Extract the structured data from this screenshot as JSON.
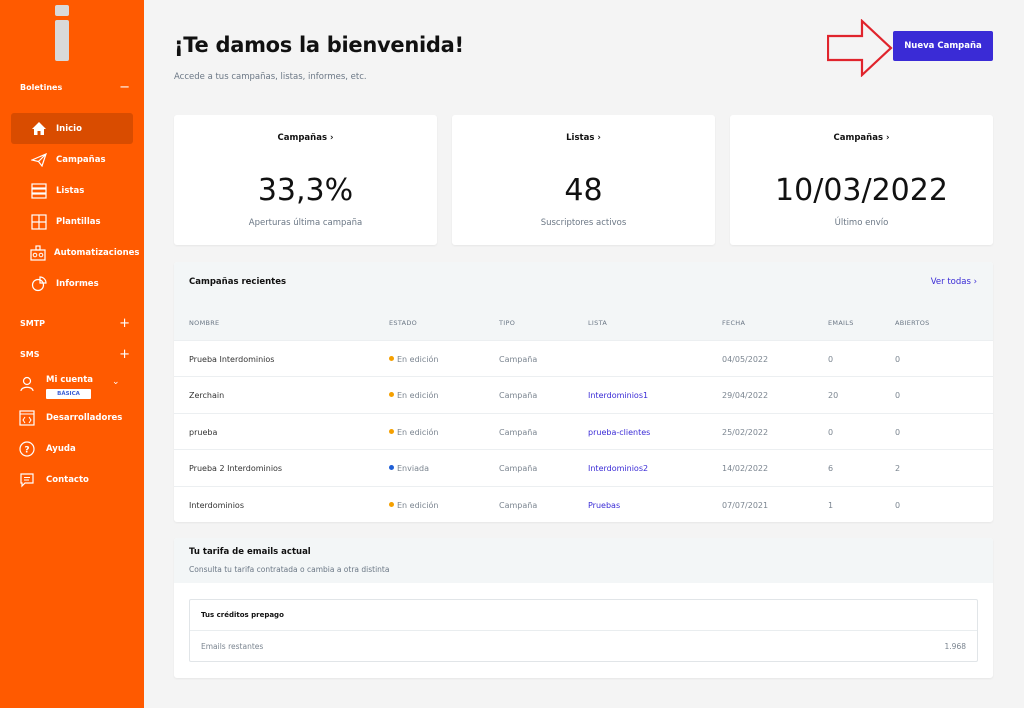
{
  "sidebar": {
    "sections": {
      "boletines": "Boletines",
      "smtp": "SMTP",
      "sms": "SMS"
    },
    "items": [
      {
        "label": "Inicio",
        "icon": "home-icon"
      },
      {
        "label": "Campañas",
        "icon": "paper-plane-icon"
      },
      {
        "label": "Listas",
        "icon": "list-icon"
      },
      {
        "label": "Plantillas",
        "icon": "template-icon"
      },
      {
        "label": "Automatizaciones",
        "icon": "automation-icon"
      },
      {
        "label": "Informes",
        "icon": "report-icon"
      }
    ],
    "account": {
      "label": "Mi cuenta",
      "plan_badge": "BÁSICA"
    },
    "extra": [
      {
        "label": "Desarrolladores",
        "icon": "code-icon"
      },
      {
        "label": "Ayuda",
        "icon": "help-icon"
      },
      {
        "label": "Contacto",
        "icon": "chat-icon"
      }
    ]
  },
  "header": {
    "title": "¡Te damos la bienvenida!",
    "subtitle": "Accede a tus campañas, listas, informes, etc.",
    "new_campaign_button": "Nueva Campaña"
  },
  "cards": [
    {
      "title": "Campañas",
      "value": "33,3%",
      "label": "Aperturas última campaña"
    },
    {
      "title": "Listas",
      "value": "48",
      "label": "Suscriptores activos"
    },
    {
      "title": "Campañas",
      "value": "10/03/2022",
      "label": "Último envío"
    }
  ],
  "recent": {
    "title": "Campañas recientes",
    "see_all": "Ver todas",
    "columns": [
      "NOMBRE",
      "ESTADO",
      "TIPO",
      "LISTA",
      "FECHA",
      "EMAILS",
      "ABIERTOS"
    ],
    "rows": [
      {
        "nombre": "Prueba Interdominios",
        "estado": "En edición",
        "tipo": "Campaña",
        "lista": "",
        "fecha": "04/05/2022",
        "emails": "0",
        "abiertos": "0"
      },
      {
        "nombre": "Zerchain",
        "estado": "En edición",
        "tipo": "Campaña",
        "lista": "Interdominios1",
        "fecha": "29/04/2022",
        "emails": "20",
        "abiertos": "0"
      },
      {
        "nombre": "prueba",
        "estado": "En edición",
        "tipo": "Campaña",
        "lista": "prueba-clientes",
        "fecha": "25/02/2022",
        "emails": "0",
        "abiertos": "0"
      },
      {
        "nombre": "Prueba 2 Interdominios",
        "estado": "Enviada",
        "tipo": "Campaña",
        "lista": "Interdominios2",
        "fecha": "14/02/2022",
        "emails": "6",
        "abiertos": "2"
      },
      {
        "nombre": "Interdominios",
        "estado": "En edición",
        "tipo": "Campaña",
        "lista": "Pruebas",
        "fecha": "07/07/2021",
        "emails": "1",
        "abiertos": "0"
      }
    ]
  },
  "plan": {
    "title": "Tu tarifa de emails actual",
    "subtitle": "Consulta tu tarifa contratada o cambia a otra distinta",
    "credits_title": "Tus créditos prepago",
    "remaining_label": "Emails restantes",
    "remaining_value": "1.968"
  },
  "colors": {
    "sidebar": "#ff5a00",
    "accent": "#3a2bd6",
    "status_editing": "#f5a000",
    "status_sent": "#1f5fd6",
    "annotation_arrow": "#e0242c"
  }
}
